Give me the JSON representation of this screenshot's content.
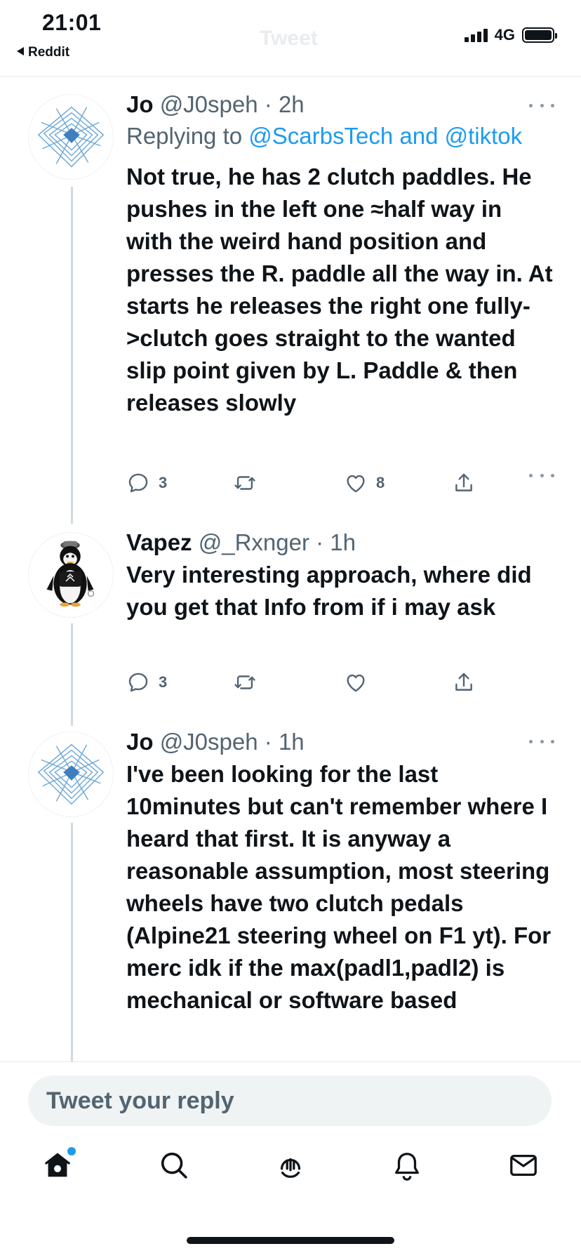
{
  "status_bar": {
    "time": "21:01",
    "back_label": "Reddit",
    "ghost_title": "Tweet",
    "network": "4G"
  },
  "tweets": [
    {
      "name": "Jo",
      "handle": "@J0speh",
      "time": "· 2h",
      "avatar_icon": "geometric-avatar-icon",
      "replying_prefix": "Replying to",
      "replying_targets": "@ScarbsTech and @tiktok",
      "text": "Not true, he has 2 clutch paddles. He pushes in the left one ≈half way in with the weird hand position and presses the R. paddle all the way in. At starts he releases the right one fully->clutch goes straight to the wanted slip point given by L. Paddle & then releases slowly",
      "replies": "3",
      "retweets": "",
      "likes": "8"
    },
    {
      "name": "Vapez",
      "handle": "@_Rxnger",
      "time": "· 1h",
      "avatar_icon": "penguin-avatar-icon",
      "text": "Very interesting approach, where did you get that Info from if i may ask",
      "replies": "3",
      "retweets": "",
      "likes": ""
    },
    {
      "name": "Jo",
      "handle": "@J0speh",
      "time": "· 1h",
      "avatar_icon": "geometric-avatar-icon",
      "text": "I've been looking for the last 10minutes but can't remember where I heard that first. It is anyway a reasonable assumption, most steering wheels have two clutch pedals (Alpine21 steering wheel on F1 yt). For merc idk if the max(padl1,padl2) is mechanical or software based"
    }
  ],
  "reply_box": {
    "placeholder": "Tweet your reply"
  },
  "tabbar": {
    "items": [
      "home-icon",
      "search-icon",
      "spaces-icon",
      "notifications-icon",
      "messages-icon"
    ]
  },
  "colors": {
    "link": "#1d9bf0",
    "secondary_text": "#536471",
    "thread_line": "#cfd9de"
  }
}
